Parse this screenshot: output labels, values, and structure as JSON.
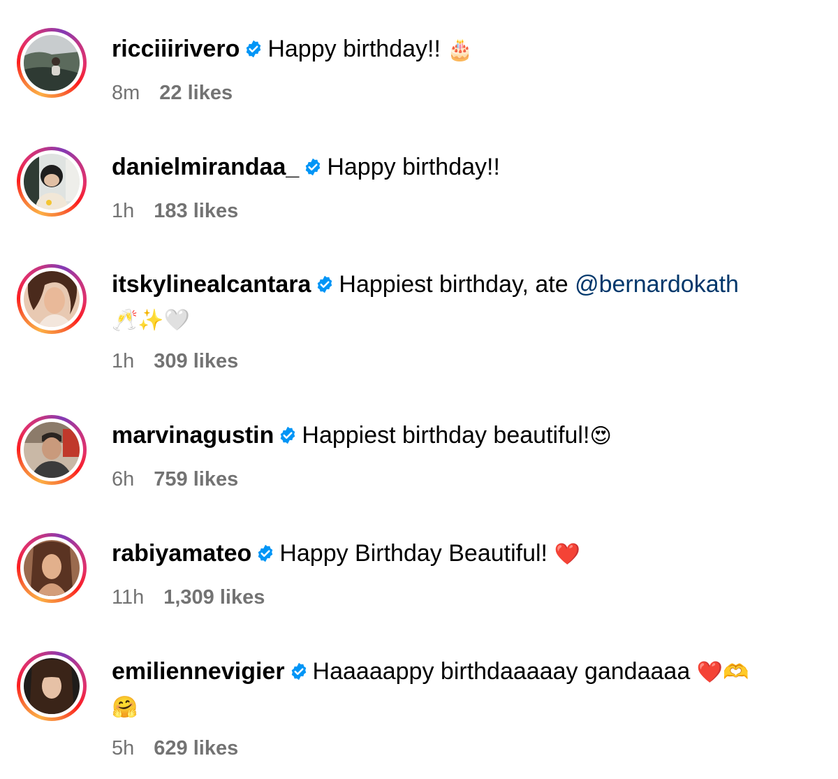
{
  "comments": [
    {
      "username": "ricciiirivero",
      "text": "Happy birthday!!",
      "emoji": "🎂",
      "time": "8m",
      "likes": "22 likes",
      "avatar_icon": "profile-photo-icon"
    },
    {
      "username": "danielmirandaa_",
      "text": "Happy birthday!!",
      "time": "1h",
      "likes": "183 likes",
      "avatar_icon": "profile-photo-icon"
    },
    {
      "username": "itskylinealcantara",
      "text": "Happiest birthday, ate",
      "mention": "@bernardokath",
      "emoji_line2": "🥂✨🤍",
      "time": "1h",
      "likes": "309 likes",
      "avatar_icon": "profile-photo-icon"
    },
    {
      "username": "marvinagustin",
      "text": "Happiest birthday beautiful!",
      "emoji": "😍",
      "time": "6h",
      "likes": "759 likes",
      "avatar_icon": "profile-photo-icon"
    },
    {
      "username": "rabiyamateo",
      "text": "Happy Birthday Beautiful!",
      "emoji": "❤️",
      "time": "11h",
      "likes": "1,309 likes",
      "avatar_icon": "profile-photo-icon"
    },
    {
      "username": "emiliennevigier",
      "text": "Haaaaappy birthdaaaaay gandaaaa",
      "emoji": "❤️🫶",
      "emoji_line2": "🤗",
      "time": "5h",
      "likes": "629 likes",
      "avatar_icon": "profile-photo-icon"
    }
  ],
  "colors": {
    "verified_badge": "#0095f6",
    "mention": "#00376b",
    "meta_text": "#737373",
    "ring_start": "#fcaf45",
    "ring_end": "#c13584"
  }
}
